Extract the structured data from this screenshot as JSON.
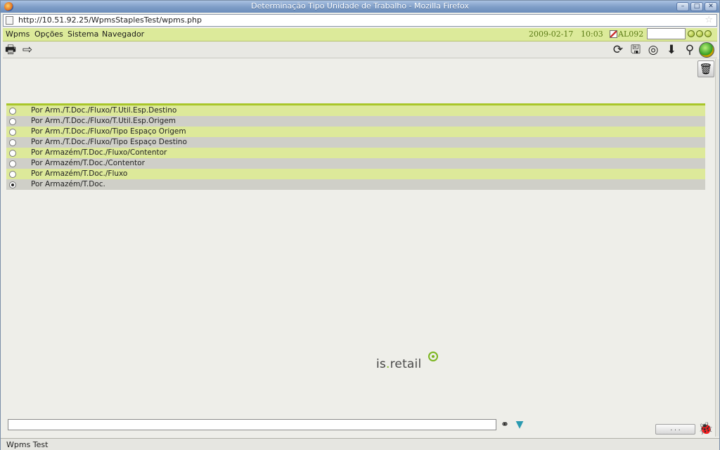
{
  "window": {
    "title": "Determinação Tipo Unidade de Trabalho - Mozilla Firefox",
    "controls": [
      "minimize",
      "maximize",
      "close"
    ]
  },
  "browser": {
    "url": "http://10.51.92.25/WpmsStaplesTest/wpms.php"
  },
  "menubar": {
    "items": [
      {
        "label": "Wpms"
      },
      {
        "label": "Opções"
      },
      {
        "label": "Sistema"
      },
      {
        "label": "Navegador"
      }
    ],
    "date": "2009-02-17",
    "time": "10:03",
    "user": "AL092",
    "field_value": ""
  },
  "toolbar": {
    "left_icons": [
      "printer-icon",
      "arrow-right-icon"
    ],
    "right_icons": [
      "refresh-icon",
      "save-icon",
      "lifebuoy-icon",
      "download-icon",
      "user-icon",
      "green-sphere-icon"
    ]
  },
  "options": [
    {
      "label": "Por Arm./T.Doc./Fluxo/T.Util.Esp.Destino",
      "selected": false
    },
    {
      "label": "Por Arm./T.Doc./Fluxo/T.Util.Esp.Origem",
      "selected": false
    },
    {
      "label": "Por Arm./T.Doc./Fluxo/Tipo Espaço Origem",
      "selected": false
    },
    {
      "label": "Por Arm./T.Doc./Fluxo/Tipo Espaço Destino",
      "selected": false
    },
    {
      "label": "Por Armazém/T.Doc./Fluxo/Contentor",
      "selected": false
    },
    {
      "label": "Por Armazém/T.Doc./Contentor",
      "selected": false
    },
    {
      "label": "Por Armazém/T.Doc./Fluxo",
      "selected": false
    },
    {
      "label": "Por Armazém/T.Doc.",
      "selected": true
    }
  ],
  "logo": {
    "part1": "is",
    "part2": ".",
    "part3": "retail"
  },
  "bottom": {
    "command_value": "",
    "dots_label": ". . ."
  },
  "status": {
    "text": "Wpms Test"
  },
  "colors": {
    "accent": "#a9c62a",
    "menubar": "#dcea9a",
    "row_light": "#dde99a",
    "row_dark": "#cfcfc8"
  }
}
